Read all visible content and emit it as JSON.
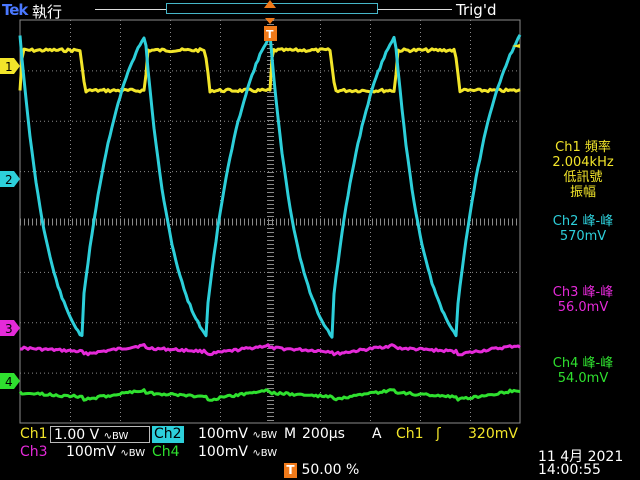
{
  "header": {
    "brand": "Tek",
    "run_state": "執行",
    "trigger_status": "Trig'd"
  },
  "channel_markers": {
    "ch1": "1",
    "ch2": "2",
    "ch3": "3",
    "ch4": "4"
  },
  "trigger_marker": "T",
  "measurements": {
    "m1_title": "Ch1 頻率",
    "m1_value": "2.004kHz",
    "m1_note1": "低訊號",
    "m1_note2": "振幅",
    "m2_title": "Ch2 峰-峰",
    "m2_value": "570mV",
    "m3_title": "Ch3 峰-峰",
    "m3_value": "56.0mV",
    "m4_title": "Ch4 峰-峰",
    "m4_value": "54.0mV"
  },
  "status_bar": {
    "ch1_label": "Ch1",
    "ch1_scale": "1.00 V",
    "ch2_label": "Ch2",
    "ch2_scale": "100mV",
    "ch3_label": "Ch3",
    "ch3_scale": "100mV",
    "ch4_label": "Ch4",
    "ch4_scale": "100mV",
    "bw_symbol": "∿BW",
    "timebase_label": "M",
    "timebase_value": "200µs",
    "trigger_mode": "A",
    "trigger_source": "Ch1",
    "trigger_slope": "ʃ",
    "trigger_level": "320mV",
    "trigger_position_marker": "T",
    "trigger_position": "50.00 %",
    "date": "11 4月  2021",
    "time": "14:00:55"
  },
  "colors": {
    "ch1": "#f2e52a",
    "ch2": "#2dcfda",
    "ch3": "#e52ad9",
    "ch4": "#2fe02f",
    "trigger": "#f07a1a",
    "graticule": "#8a8a8a"
  },
  "chart_data": {
    "type": "line",
    "time_per_div": "200µs",
    "divisions": {
      "x": 10,
      "y": 8
    },
    "series": [
      {
        "name": "Ch1",
        "shape": "square",
        "high_div": 3.4,
        "low_div": 2.6,
        "period_div": 2.5,
        "duty": 0.48
      },
      {
        "name": "Ch2",
        "shape": "exponential-charge-discharge",
        "high_div": 3.7,
        "low_div": -2.3,
        "period_div": 2.5
      },
      {
        "name": "Ch3",
        "shape": "small-ripple",
        "baseline_div": -2.6,
        "ripple_div": 0.18,
        "period_div": 2.5
      },
      {
        "name": "Ch4",
        "shape": "small-ripple",
        "baseline_div": -3.5,
        "ripple_div": 0.2,
        "period_div": 2.5
      }
    ]
  }
}
